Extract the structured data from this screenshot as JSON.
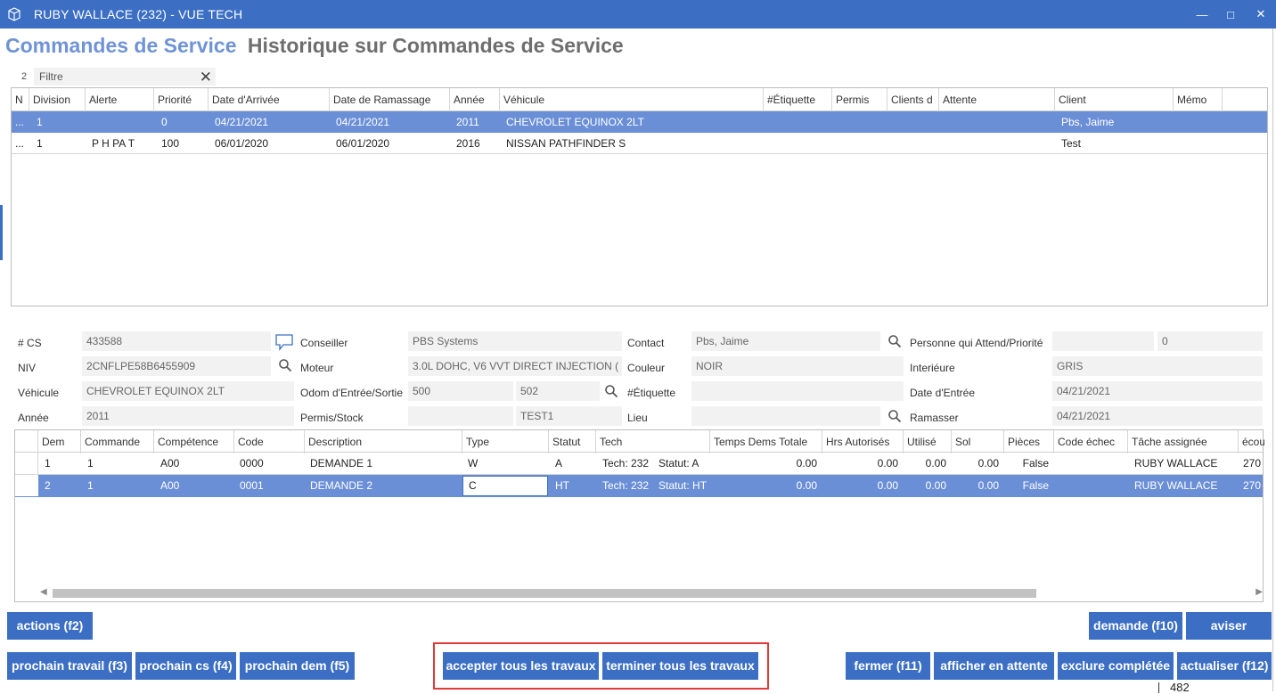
{
  "window": {
    "title": "RUBY WALLACE (232) - VUE TECH",
    "minimize": "—",
    "maximize": "□",
    "close": "✕"
  },
  "headings": {
    "active": "Commandes de Service",
    "inactive": "Historique sur Commandes de Service"
  },
  "filter": {
    "count": "2",
    "placeholder": "Filtre",
    "clear": "✕"
  },
  "orders_table": {
    "headers": [
      "N",
      "Division",
      "Alerte",
      "Priorité",
      "Date d'Arrivée",
      "Date de Ramassage",
      "Année",
      "Véhicule",
      "#Étiquette",
      "Permis",
      "Clients d",
      "Attente",
      "Client",
      "Mémo"
    ],
    "rows": [
      {
        "n": "...",
        "division": "1",
        "alerte": "",
        "priorite": "0",
        "arrivee": "04/21/2021",
        "ramassage": "04/21/2021",
        "annee": "2011",
        "vehicule": "CHEVROLET EQUINOX 2LT",
        "etiquette": "",
        "permis": "",
        "clients": "",
        "attente": "",
        "client": "Pbs, Jaime",
        "memo": ""
      },
      {
        "n": "...",
        "division": "1",
        "alerte": "P H PA T",
        "priorite": "100",
        "arrivee": "06/01/2020",
        "ramassage": "06/01/2020",
        "annee": "2016",
        "vehicule": "NISSAN PATHFINDER S",
        "etiquette": "",
        "permis": "",
        "clients": "",
        "attente": "",
        "client": "Test",
        "memo": ""
      }
    ]
  },
  "details": {
    "cs_label": "# CS",
    "cs_value": "433588",
    "niv_label": "NIV",
    "niv_value": "2CNFLPE58B6455909",
    "vehicule_label": "Véhicule",
    "vehicule_value": "CHEVROLET EQUINOX 2LT",
    "annee_label": "Année",
    "annee_value": "2011",
    "conseiller_label": "Conseiller",
    "conseiller_value": "PBS Systems",
    "moteur_label": "Moteur",
    "moteur_value": "3.0L DOHC, V6 VVT DIRECT INJECTION (",
    "odom_label": "Odom d'Entrée/Sortie",
    "odom_in": "500",
    "odom_out": "502",
    "permis_label": "Permis/Stock",
    "permis_value": "",
    "stock_value": "TEST1",
    "contact_label": "Contact",
    "contact_value": "Pbs, Jaime",
    "couleur_label": "Couleur",
    "couleur_value": "NOIR",
    "etiquette_label": "#Étiquette",
    "etiquette_value": "",
    "lieu_label": "Lieu",
    "lieu_value": "",
    "personne_label": "Personne qui Attend/Priorité",
    "personne_value": "",
    "priorite_value": "0",
    "interieure_label": "Interiéure",
    "interieure_value": "GRIS",
    "date_entree_label": "Date d'Entrée",
    "date_entree_value": "04/21/2021",
    "ramasser_label": "Ramasser",
    "ramasser_value": "04/21/2021"
  },
  "requests_table": {
    "headers": [
      "Dem",
      "Commande",
      "Compétence",
      "Code",
      "Description",
      "Type",
      "Statut",
      "Tech",
      "Temps Dems Totale",
      "Hrs Autorisés",
      "Utilisé",
      "Sol",
      "Pièces",
      "Code échec",
      "Tâche assignée",
      "écou"
    ],
    "rows": [
      {
        "dem": "1",
        "commande": "1",
        "competence": "A00",
        "code": "0000",
        "description": "DEMANDE 1",
        "type": "W",
        "statut": "A",
        "tech": "Tech: 232",
        "tech_statut": "Statut: A",
        "temps": "0.00",
        "hrs": "0.00",
        "utilise": "0.00",
        "sol": "0.00",
        "pieces": "False",
        "code_echec": "",
        "tache": "RUBY WALLACE",
        "ecou": "270"
      },
      {
        "dem": "2",
        "commande": "1",
        "competence": "A00",
        "code": "0001",
        "description": "DEMANDE 2",
        "type": "C",
        "statut": "HT",
        "tech": "Tech: 232",
        "tech_statut": "Statut: HT",
        "temps": "0.00",
        "hrs": "0.00",
        "utilise": "0.00",
        "sol": "0.00",
        "pieces": "False",
        "code_echec": "",
        "tache": "RUBY WALLACE",
        "ecou": "270"
      }
    ]
  },
  "buttons": {
    "actions": "actions (f2)",
    "demande": "demande (f10)",
    "aviser": "aviser",
    "prochain_travail": "prochain travail (f3)",
    "prochain_cs": "prochain cs (f4)",
    "prochain_dem": "prochain dem (f5)",
    "accepter": "accepter tous les travaux",
    "terminer": "terminer tous les travaux",
    "fermer": "fermer (f11)",
    "afficher": "afficher en attente",
    "exclure": "exclure complétée",
    "actualiser": "actualiser (f12)"
  },
  "fragment_text": "482",
  "colors": {
    "accent": "#3c6fc4",
    "selection": "#6b8fd6",
    "highlight_box": "#e03a3a"
  }
}
